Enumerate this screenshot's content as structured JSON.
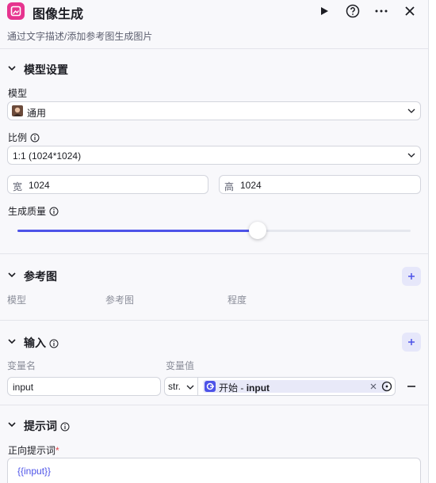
{
  "header": {
    "title": "图像生成",
    "subtitle": "通过文字描述/添加参考图生成图片"
  },
  "model_settings": {
    "section_title": "模型设置",
    "model_label": "模型",
    "model_value": "通用",
    "ratio_label": "比例",
    "ratio_value": "1:1 (1024*1024)",
    "width_prefix": "宽",
    "width_value": "1024",
    "height_prefix": "高",
    "height_value": "1024",
    "quality_label": "生成质量",
    "quality_level": 0.61
  },
  "reference": {
    "section_title": "参考图",
    "columns": [
      "模型",
      "参考图",
      "程度"
    ]
  },
  "inputs": {
    "section_title": "输入",
    "col_name": "变量名",
    "col_value": "变量值",
    "row": {
      "name": "input",
      "type": "str.",
      "source": "开始",
      "separator": "-",
      "variable": "input"
    }
  },
  "prompt": {
    "section_title": "提示词",
    "positive_label": "正向提示词",
    "required_mark": "*",
    "positive_value": "{{input}}"
  },
  "colors": {
    "accent": "#4d53e8",
    "app_icon": "#e6338f"
  }
}
